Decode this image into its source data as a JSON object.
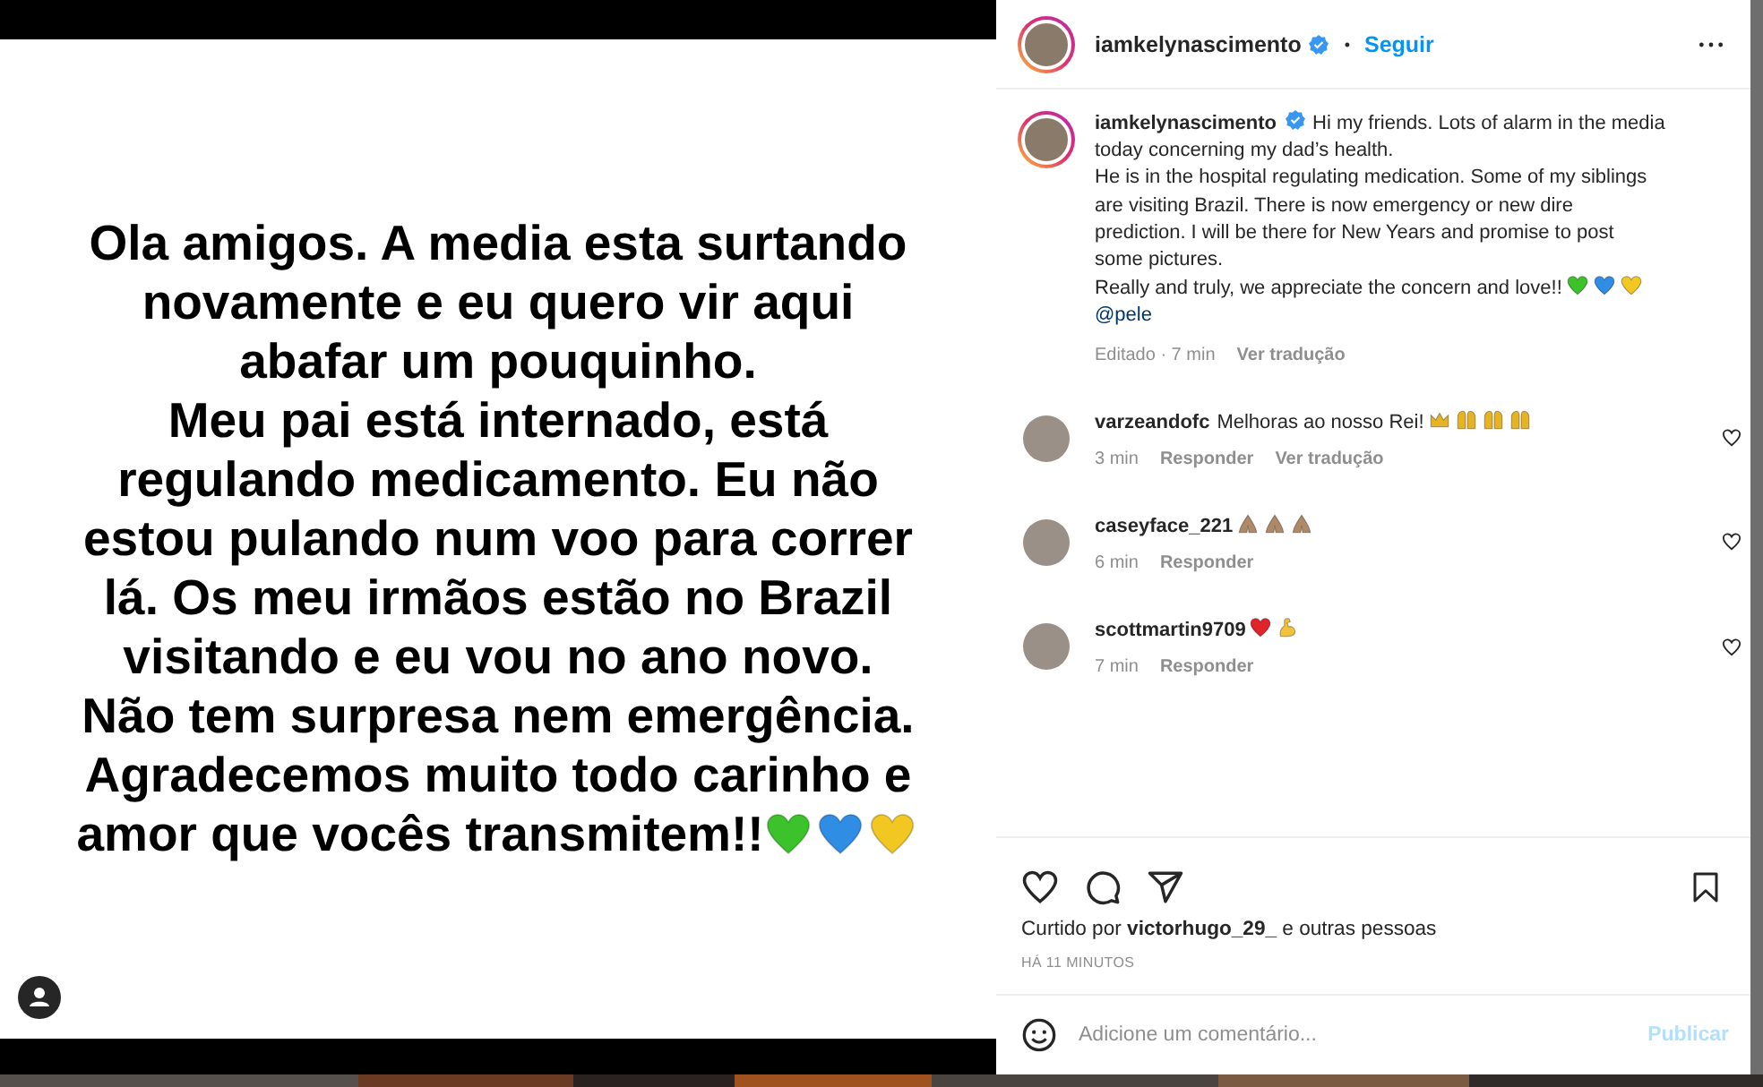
{
  "post_image": {
    "lines": [
      "Ola amigos. A media esta surtando",
      "novamente e eu quero vir aqui",
      "abafar um pouquinho.",
      "Meu pai está internado, está",
      "regulando medicamento. Eu não",
      "estou pulando num voo para correr",
      "lá. Os meu irmãos estão no Brazil",
      "visitando e eu vou no ano novo.",
      "Não tem surpresa nem emergência.",
      "Agradecemos muito todo carinho e",
      "amor que vocês transmitem!!"
    ],
    "emojis": [
      {
        "kind": "heart",
        "color": "#3cc22a"
      },
      {
        "kind": "heart",
        "color": "#2f8de4"
      },
      {
        "kind": "heart",
        "color": "#f2c722"
      }
    ]
  },
  "header": {
    "username": "iamkelynascimento",
    "verified": true,
    "separator": "•",
    "follow": "Seguir"
  },
  "caption": {
    "username": "iamkelynascimento",
    "verified": true,
    "lines": [
      "Hi my friends. Lots of alarm in the media",
      "today concerning my dad’s health.",
      "He is in the hospital regulating medication. Some of my siblings",
      "are visiting Brazil. There is now emergency or new dire",
      "prediction. I will be there for New Years and promise to post",
      "some pictures.",
      "Really and truly, we appreciate the concern and love!!"
    ],
    "emojis": [
      {
        "kind": "heart",
        "color": "#3cc22a"
      },
      {
        "kind": "heart",
        "color": "#2f8de4"
      },
      {
        "kind": "heart",
        "color": "#f2c722"
      }
    ],
    "mention": "@pele",
    "edited": "Editado · 7 min",
    "translate": "Ver tradução"
  },
  "comments": [
    {
      "username": "varzeandofc",
      "text": "Melhoras ao nosso Rei!",
      "emojis": [
        {
          "kind": "crown",
          "color": "#e6b422"
        },
        {
          "kind": "raised-hands",
          "color": "#e6b422"
        },
        {
          "kind": "raised-hands",
          "color": "#e6b422"
        },
        {
          "kind": "raised-hands",
          "color": "#e6b422"
        }
      ],
      "time": "3 min",
      "reply": "Responder",
      "translate": "Ver tradução",
      "liked": false
    },
    {
      "username": "caseyface_221",
      "emojis": [
        {
          "kind": "praying-hands",
          "color": "#b08a68"
        },
        {
          "kind": "praying-hands",
          "color": "#b08a68"
        },
        {
          "kind": "praying-hands",
          "color": "#b08a68"
        }
      ],
      "time": "6 min",
      "reply": "Responder",
      "liked": false
    },
    {
      "username": "scottmartin9709",
      "emojis": [
        {
          "kind": "heart",
          "color": "#e0242c"
        },
        {
          "kind": "biceps",
          "color": "#f2c23a"
        }
      ],
      "time": "7 min",
      "reply": "Responder",
      "liked": false
    }
  ],
  "actions": {
    "liked": false,
    "saved": false
  },
  "likes": {
    "prefix": "Curtido por",
    "user": "victorhugo_29_",
    "suffix": "e outras pessoas"
  },
  "timestamp": "HÁ 11 MINUTOS",
  "comment_box": {
    "placeholder": "Adicione um comentário...",
    "publish": "Publicar",
    "publish_disabled": true
  }
}
